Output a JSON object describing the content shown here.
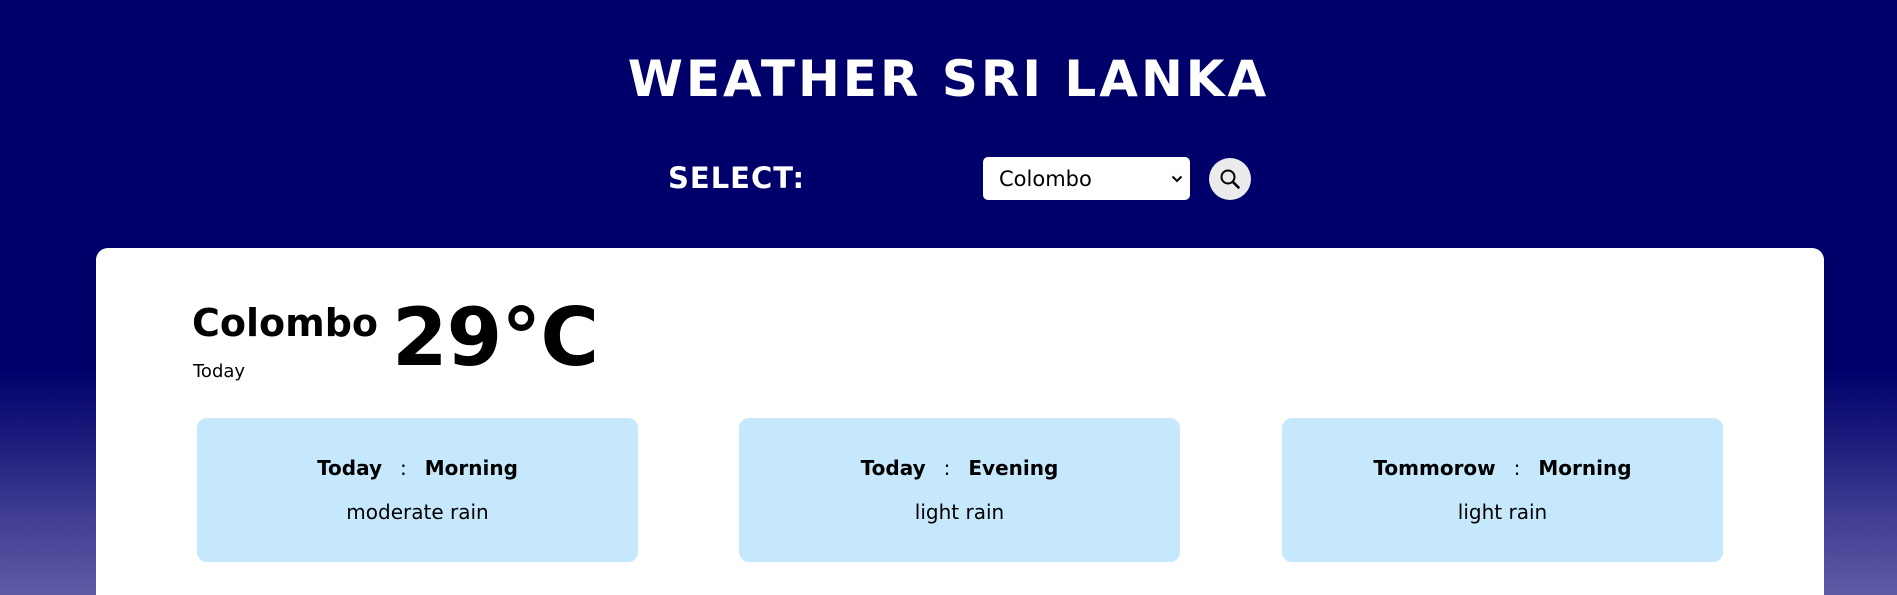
{
  "header": {
    "title": "WEATHER SRI LANKA"
  },
  "controls": {
    "select_label": "SELECT:",
    "city_select_value": "Colombo",
    "search_icon": "search-icon",
    "dropdown_icon": "chevron-down-icon"
  },
  "current": {
    "city": "Colombo",
    "day": "Today",
    "temperature": "29°C"
  },
  "forecasts": [
    {
      "day": "Today",
      "separator": ":",
      "period": "Morning",
      "condition": "moderate rain"
    },
    {
      "day": "Today",
      "separator": ":",
      "period": "Evening",
      "condition": "light rain"
    },
    {
      "day": "Tommorow",
      "separator": ":",
      "period": "Morning",
      "condition": "light rain"
    }
  ],
  "colors": {
    "background_top": "#00006b",
    "background_bottom": "#5f5ba6",
    "card": "#ffffff",
    "forecast_box": "#c6e8fc",
    "search_button": "#ebebeb"
  }
}
